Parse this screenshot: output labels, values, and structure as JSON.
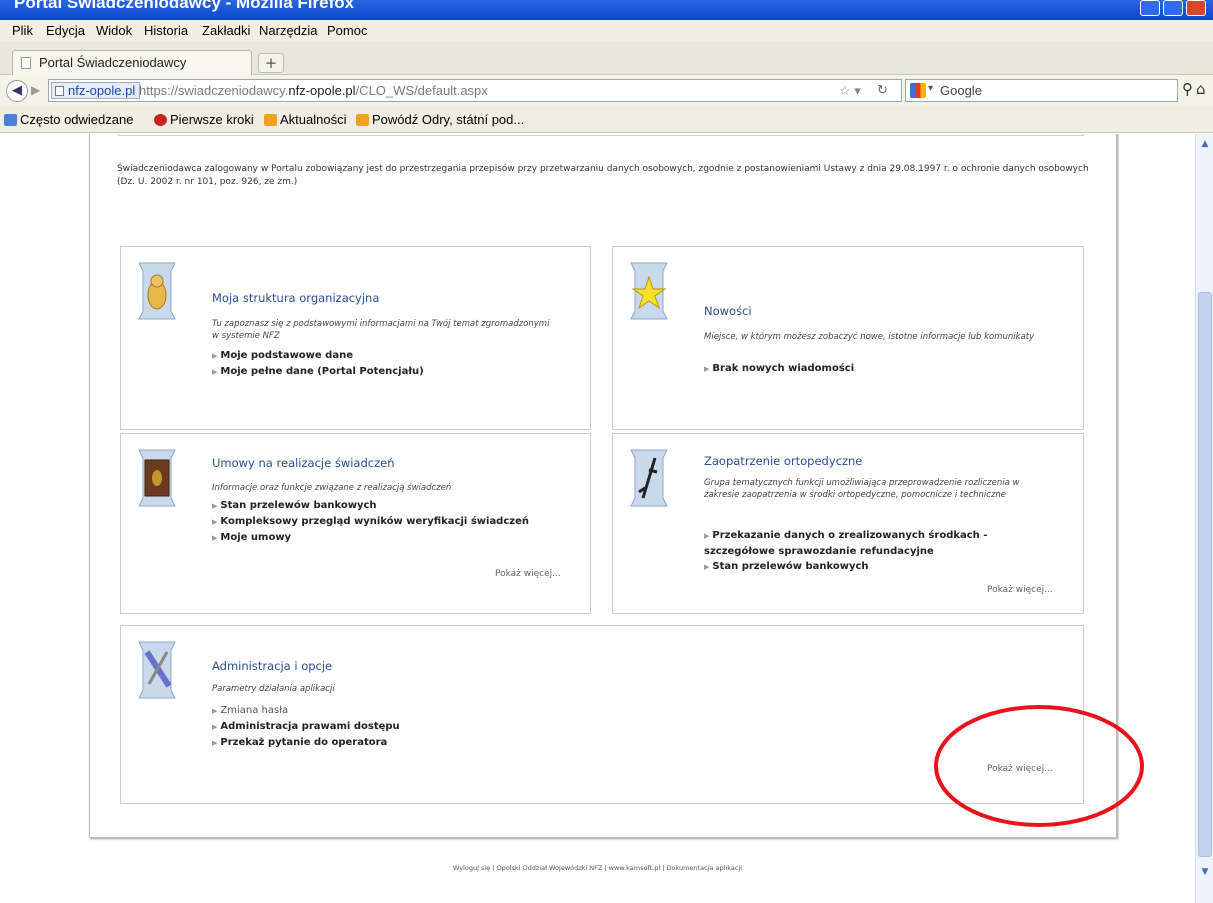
{
  "window": {
    "title": "Portal Świadczeniodawcy - Mozilla Firefox"
  },
  "menu": [
    "Plik",
    "Edycja",
    "Widok",
    "Historia",
    "Zakładki",
    "Narzędzia",
    "Pomoc"
  ],
  "tab": {
    "label": "Portal Świadczeniodawcy",
    "new_tab": "+"
  },
  "nav": {
    "site_identity": "nfz-opole.pl",
    "url_prefix": "https://swiadczeniodawcy.",
    "url_domain": "nfz-opole.pl",
    "url_path": "/CLO_WS/default.aspx",
    "search_engine": "Google"
  },
  "bookmarks": [
    "Często odwiedzane",
    "Pierwsze kroki",
    "Aktualności",
    "Powódź Odry, státní pod..."
  ],
  "notice": "Świadczeniodawca zalogowany w Portalu zobowiązany jest do przestrzegania przepisów przy przetwarzaniu danych osobowych, zgodnie z postanowieniami Ustawy z dnia 29.08.1997 r. o ochronie danych osobowych (Dz. U. 2002 r. nr 101, poz. 926, ze zm.)",
  "tiles": {
    "structure": {
      "title": "Moja struktura organizacyjna",
      "desc": "Tu zapoznasz się z podstawowymi informacjami na Twój temat zgromadzonymi w systemie NFZ",
      "links": [
        "Moje podstawowe dane",
        "Moje pełne dane (Portal Potencjału)"
      ]
    },
    "news": {
      "title": "Nowości",
      "desc": "Miejsce, w którym możesz zobaczyć nowe, istotne informacje lub komunikaty",
      "links": [
        "Brak nowych wiadomości"
      ]
    },
    "contracts": {
      "title": "Umowy na realizacje świadczeń",
      "desc": "Informacje oraz funkcje związane z realizacją świadczeń",
      "links": [
        "Stan przelewów bankowych",
        "Kompleksowy przegląd wyników weryfikacji świadczeń",
        "Moje umowy"
      ],
      "more": "Pokaż więcej..."
    },
    "ortho": {
      "title": "Zaopatrzenie ortopedyczne",
      "desc": "Grupa tematycznych funkcji umożliwiająca przeprowadzenie rozliczenia w zakresie zaopatrzenia w środki ortopedyczne, pomocnicze i techniczne",
      "links": [
        "Przekazanie danych o zrealizowanych środkach - szczegółowe sprawozdanie refundacyjne",
        "Stan przelewów bankowych"
      ],
      "more": "Pokaż więcej..."
    },
    "admin": {
      "title": "Administracja i opcje",
      "desc": "Parametry działania aplikacji",
      "links": [
        "Zmiana hasła",
        "Administracja prawami dostępu",
        "Przekaż pytanie do operatora"
      ],
      "more": "Pokaż więcej..."
    }
  },
  "footer": "Wyloguj się | Opolski Oddział Wojewódzki NFZ | www.kamsoft.pl | Dokumentacja aplikacji",
  "colors": {
    "annotation": "#e8141c",
    "link_title": "#2b4e92",
    "titlebar": "#0c48cf"
  }
}
